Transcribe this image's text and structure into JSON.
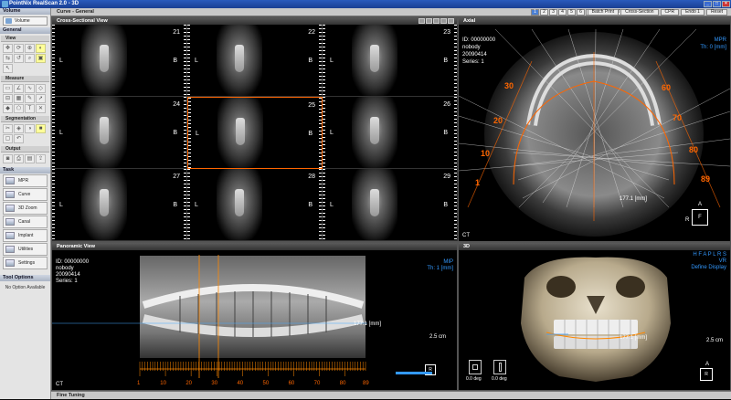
{
  "app": {
    "title": "PointNix RealScan 2.0 - 3D"
  },
  "left": {
    "volume_header": "Volume",
    "volume_button": "Volume",
    "general_header": "General",
    "view_label": "View",
    "measure_label": "Measure",
    "segmentation_label": "Segmentation",
    "output_label": "Output",
    "task_header": "Task",
    "tasks": [
      "MPR",
      "Curve",
      "3D Zoom",
      "Canal",
      "Implant",
      "Utilities",
      "Settings"
    ],
    "tool_options_header": "Tool Options",
    "tool_options_text": "No Option Available"
  },
  "toolbar": {
    "breadcrumb": "Curve - General",
    "slice_numbers": [
      "1",
      "2",
      "3",
      "4",
      "5",
      "6",
      "7",
      "8",
      "9",
      "10",
      "11",
      "12"
    ],
    "actions": [
      "Batch Print",
      "Cross-Section",
      "CPR",
      "Endo 1",
      "Reset"
    ]
  },
  "cross": {
    "title": "Cross-Sectional View",
    "cells": [
      {
        "n": "21",
        "l": "L",
        "r": "B"
      },
      {
        "n": "22",
        "l": "L",
        "r": "B"
      },
      {
        "n": "23",
        "l": "L",
        "r": "B"
      },
      {
        "n": "24",
        "l": "L",
        "r": "B"
      },
      {
        "n": "25",
        "l": "L",
        "r": "B"
      },
      {
        "n": "26",
        "l": "L",
        "r": "B"
      },
      {
        "n": "27",
        "l": "L",
        "r": "B"
      },
      {
        "n": "28",
        "l": "L",
        "r": "B"
      },
      {
        "n": "29",
        "l": "L",
        "r": "B"
      }
    ]
  },
  "axial": {
    "title": "Axial",
    "id": "ID: 00000000",
    "name": "nobody",
    "date": "20090414",
    "series": "Series: 1",
    "mode": "MPR",
    "thick": "Th: 0 [mm]",
    "marks": [
      "30",
      "20",
      "10",
      "1",
      "60",
      "70",
      "80",
      "89"
    ],
    "measure": "177.1 [mm]",
    "ct": "CT",
    "orient_top": "A",
    "orient_left": "R",
    "orient_box": "F"
  },
  "pano": {
    "title": "Panoramic View",
    "id": "ID: 00000000",
    "name": "nobody",
    "date": "20090414",
    "series": "Series: 1",
    "mode": "MIP",
    "thick": "Th: 1 [mm]",
    "measure": "177.1 [mm]",
    "scale": "2.5 cm",
    "ct": "CT",
    "ruler_labels": [
      "1",
      "10",
      "20",
      "30",
      "40",
      "50",
      "60",
      "70",
      "80",
      "89"
    ],
    "orient": "R"
  },
  "three_d": {
    "title": "3D",
    "toolbar_icons": "H F A P L R S",
    "mode": "VR",
    "preset": "Define Display",
    "measure": "177.1 [mm]",
    "scale": "2.5 cm",
    "deg1": "0.0 deg",
    "deg2": "0.0 deg",
    "orient_top": "A",
    "orient_box": "R"
  },
  "bottom": {
    "label": "Fine Tuning"
  }
}
